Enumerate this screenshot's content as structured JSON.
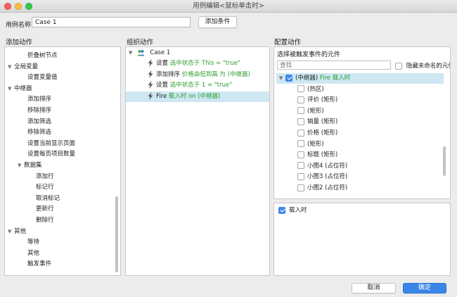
{
  "window": {
    "title": "用例编辑<鼠标单击时>"
  },
  "case": {
    "name_label": "用例名称",
    "name_value": "Case 1",
    "add_condition": "添加条件"
  },
  "columns": {
    "add_action": "添加动作",
    "organize_action": "组织动作",
    "config_action": "配置动作"
  },
  "left_tree": [
    {
      "label": "折叠树节点",
      "level": 2,
      "arrow": ""
    },
    {
      "label": "全局变量",
      "level": 0,
      "arrow": "▼"
    },
    {
      "label": "设置变量值",
      "level": 2,
      "arrow": ""
    },
    {
      "label": "中继器",
      "level": 0,
      "arrow": "▼"
    },
    {
      "label": "添加排序",
      "level": 2,
      "arrow": ""
    },
    {
      "label": "移除排序",
      "level": 2,
      "arrow": ""
    },
    {
      "label": "添加筛选",
      "level": 2,
      "arrow": ""
    },
    {
      "label": "移除筛选",
      "level": 2,
      "arrow": ""
    },
    {
      "label": "设置当前显示页面",
      "level": 2,
      "arrow": ""
    },
    {
      "label": "设置每页项目数量",
      "level": 2,
      "arrow": ""
    },
    {
      "label": "数据集",
      "level": 1,
      "arrow": "▼"
    },
    {
      "label": "添加行",
      "level": 3,
      "arrow": ""
    },
    {
      "label": "标记行",
      "level": 3,
      "arrow": ""
    },
    {
      "label": "取消标记",
      "level": 3,
      "arrow": ""
    },
    {
      "label": "更新行",
      "level": 3,
      "arrow": ""
    },
    {
      "label": "删除行",
      "level": 3,
      "arrow": ""
    },
    {
      "label": "其他",
      "level": 0,
      "arrow": "▼"
    },
    {
      "label": "等待",
      "level": 2,
      "arrow": ""
    },
    {
      "label": "其他",
      "level": 2,
      "arrow": ""
    },
    {
      "label": "触发事件",
      "level": 2,
      "arrow": ""
    }
  ],
  "organize": {
    "case_label": "Case 1",
    "actions": [
      {
        "verb": "设置",
        "detail": "选中状态于 This = \"true\"",
        "selected": false
      },
      {
        "verb": "添加排序",
        "detail": "价格由低到高 为 (中继器)",
        "selected": false
      },
      {
        "verb": "设置",
        "detail": "选中状态于 1 = \"true\"",
        "selected": false
      },
      {
        "verb": "Fire",
        "detail": "载入时 on (中继器)",
        "selected": true
      }
    ]
  },
  "config": {
    "select_title": "选择被触发事件的元件",
    "search_placeholder": "查找",
    "hide_unnamed": "隐藏未命名的元件",
    "tree": [
      {
        "label": "(中继器)",
        "suffix": "Fire 载入时",
        "checked": true,
        "level": 0,
        "selected": true
      },
      {
        "label": "(热区)",
        "suffix": "",
        "checked": false,
        "level": 1,
        "selected": false
      },
      {
        "label": "评价 (矩形)",
        "suffix": "",
        "checked": false,
        "level": 1,
        "selected": false
      },
      {
        "label": "(矩形)",
        "suffix": "",
        "checked": false,
        "level": 1,
        "selected": false
      },
      {
        "label": "销量 (矩形)",
        "suffix": "",
        "checked": false,
        "level": 1,
        "selected": false
      },
      {
        "label": "价格 (矩形)",
        "suffix": "",
        "checked": false,
        "level": 1,
        "selected": false
      },
      {
        "label": "(矩形)",
        "suffix": "",
        "checked": false,
        "level": 1,
        "selected": false
      },
      {
        "label": "标题 (矩形)",
        "suffix": "",
        "checked": false,
        "level": 1,
        "selected": false
      },
      {
        "label": "小图4 (占位符)",
        "suffix": "",
        "checked": false,
        "level": 1,
        "selected": false
      },
      {
        "label": "小图3 (占位符)",
        "suffix": "",
        "checked": false,
        "level": 1,
        "selected": false
      },
      {
        "label": "小图2 (占位符)",
        "suffix": "",
        "checked": false,
        "level": 1,
        "selected": false
      }
    ],
    "events": [
      {
        "label": "载入时",
        "checked": true
      }
    ]
  },
  "footer": {
    "cancel": "取消",
    "ok": "确定"
  },
  "colors": {
    "accent": "#3a85e8",
    "highlight": "#cde8f3",
    "action_text": "#2e9d2e"
  }
}
